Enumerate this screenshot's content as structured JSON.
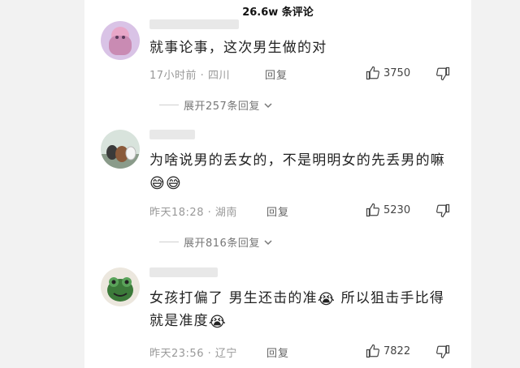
{
  "header": {
    "title": "26.6w 条评论"
  },
  "comments": [
    {
      "text": "就事论事，这次男生做的对",
      "emoji": [],
      "meta": "17小时前 · 四川",
      "reply_label": "回复",
      "likes": "3750",
      "expand": "展开257条回复"
    },
    {
      "text": "为啥说男的丢女的，不是明明女的先丢男的嘛",
      "emoji": [
        "😅",
        "😅"
      ],
      "meta": "昨天18:28 · 湖南",
      "reply_label": "回复",
      "likes": "5230",
      "expand": "展开816条回复"
    },
    {
      "text_a": "女孩打偏了 男生还击的准",
      "emoji_a": "😭",
      "text_b": " 所以狙击手比得就是准度",
      "emoji_b": "😭",
      "meta": "昨天23:56 · 辽宁",
      "reply_label": "回复",
      "likes": "7822"
    }
  ],
  "colors": {
    "accent_text": "#222222",
    "meta_text": "#999999",
    "background": "#ffffff"
  }
}
